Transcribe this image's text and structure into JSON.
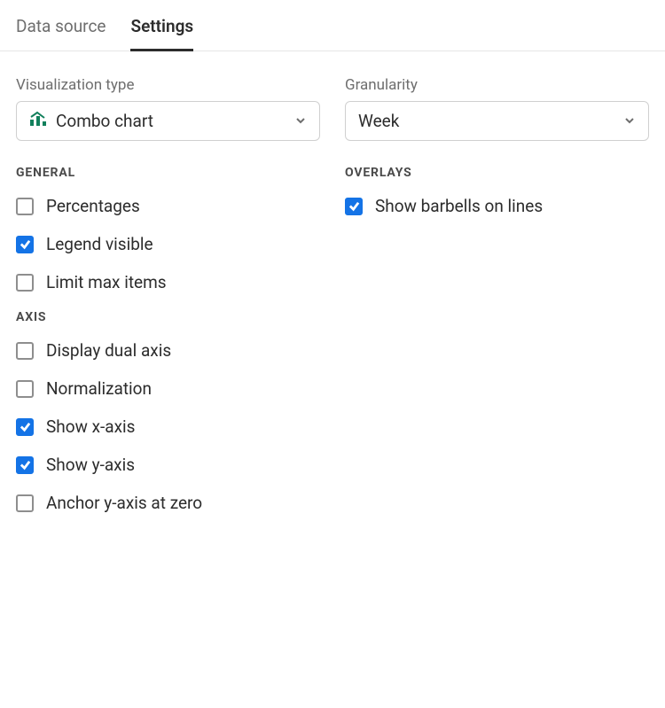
{
  "tabs": {
    "data_source": "Data source",
    "settings": "Settings"
  },
  "fields": {
    "viz_type": {
      "label": "Visualization type",
      "value": "Combo chart"
    },
    "granularity": {
      "label": "Granularity",
      "value": "Week"
    }
  },
  "sections": {
    "general": {
      "heading": "General",
      "options": {
        "percentages": {
          "label": "Percentages",
          "checked": false
        },
        "legend_visible": {
          "label": "Legend visible",
          "checked": true
        },
        "limit_max_items": {
          "label": "Limit max items",
          "checked": false
        }
      }
    },
    "axis": {
      "heading": "Axis",
      "options": {
        "display_dual_axis": {
          "label": "Display dual axis",
          "checked": false
        },
        "normalization": {
          "label": "Normalization",
          "checked": false
        },
        "show_x_axis": {
          "label": "Show x-axis",
          "checked": true
        },
        "show_y_axis": {
          "label": "Show y-axis",
          "checked": true
        },
        "anchor_y_zero": {
          "label": "Anchor y-axis at zero",
          "checked": false
        }
      }
    },
    "overlays": {
      "heading": "Overlays",
      "options": {
        "show_barbells": {
          "label": "Show barbells on lines",
          "checked": true
        }
      }
    }
  },
  "colors": {
    "accent": "#1473e6",
    "combo_icon": "#12805c"
  }
}
